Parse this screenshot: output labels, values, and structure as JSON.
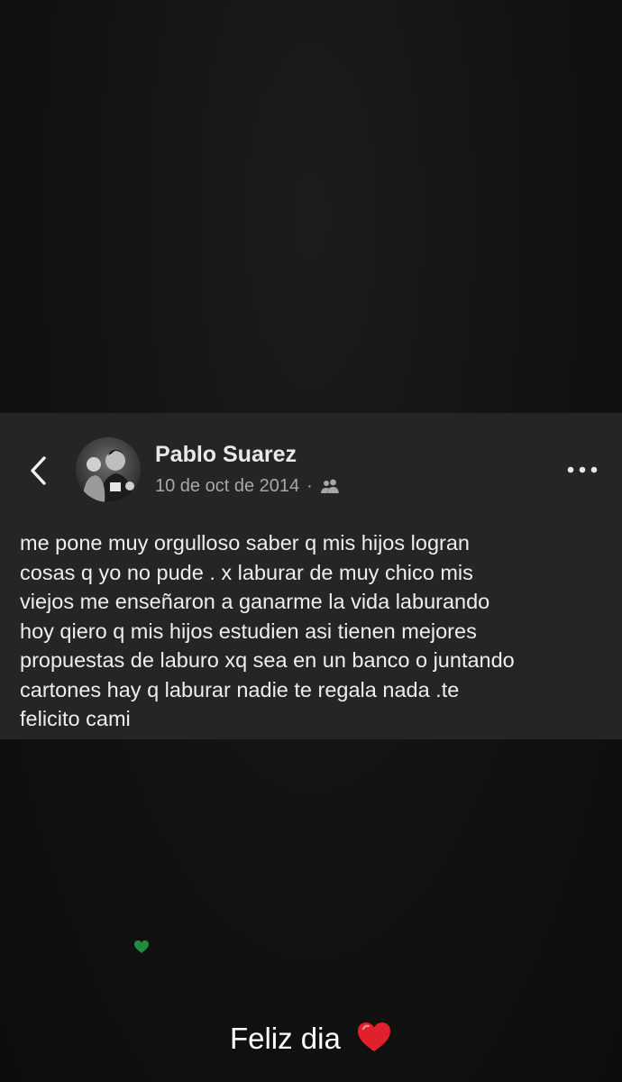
{
  "post": {
    "author": "Pablo Suarez",
    "date": "10 de oct de 2014",
    "separator": "·",
    "audience_icon": "friends-icon",
    "text": "me pone muy orgulloso saber q mis hijos logran\ncosas q yo no pude . x laburar de muy chico mis\nviejos me enseñaron a ganarme la vida laburando\nhoy qiero q mis hijos estudien asi tienen mejores\npropuestas de laburo xq sea en un banco o juntando\ncartones hay q laburar nadie te regala nada .te\nfelicito cami"
  },
  "header": {
    "back_icon": "chevron-left-icon",
    "more_icon": "more-horizontal-icon"
  },
  "sticker": {
    "icon": "green-heart-icon",
    "color": "#1e8e3e"
  },
  "caption": {
    "text": "Feliz dia",
    "emoji_icon": "red-heart-icon",
    "emoji_color": "#e0202a"
  },
  "colors": {
    "card_background": "#242526",
    "page_background": "#121212",
    "secondary_text": "#a8a8a8"
  }
}
